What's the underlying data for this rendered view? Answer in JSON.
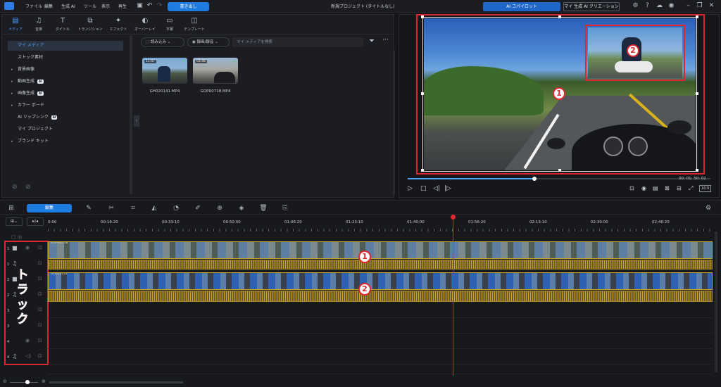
{
  "menu": [
    "ファイル",
    "編集",
    "生成 AI",
    "ツール",
    "表示",
    "再生"
  ],
  "export_label": "書き出し",
  "project_title": "新規プロジェクト (タイトルなし)",
  "ai_copilot_label": "AI コパイロット",
  "ai_create_label": "マイ 生成 AI クリエーション",
  "tabs": [
    {
      "label": "メディア",
      "icon": "media-icon"
    },
    {
      "label": "音楽",
      "icon": "music-icon"
    },
    {
      "label": "タイトル",
      "icon": "title-icon"
    },
    {
      "label": "トランジション",
      "icon": "transition-icon"
    },
    {
      "label": "エフェクト",
      "icon": "effect-icon"
    },
    {
      "label": "オーバーレイ",
      "icon": "overlay-icon"
    },
    {
      "label": "字幕",
      "icon": "subtitle-icon"
    },
    {
      "label": "テンプレート",
      "icon": "template-icon"
    }
  ],
  "sidebar": {
    "items": [
      {
        "label": "マイ メディア",
        "arrow": "",
        "badge": ""
      },
      {
        "label": "ストック素材",
        "arrow": "",
        "badge": ""
      },
      {
        "label": "背景画像",
        "arrow": "▸",
        "badge": ""
      },
      {
        "label": "動画生成",
        "arrow": "▸",
        "badge": "AI"
      },
      {
        "label": "画像生成",
        "arrow": "▸",
        "badge": "AI"
      },
      {
        "label": "カラー ボード",
        "arrow": "▸",
        "badge": ""
      },
      {
        "label": "AI リップシンク",
        "arrow": "",
        "badge": "AI"
      },
      {
        "label": "マイ プロジェクト",
        "arrow": "",
        "badge": ""
      },
      {
        "label": "ブランド キット",
        "arrow": "▸",
        "badge": ""
      }
    ]
  },
  "media_toolbar": {
    "import_label": "読み込み",
    "capture_label": "録画/録音",
    "search_placeholder": "マイ メディアを検索"
  },
  "media": [
    {
      "name": "GH020141.MP4",
      "duration": "11:47"
    },
    {
      "name": "GOPR0718.MP4",
      "duration": "03:46"
    }
  ],
  "preview": {
    "timecode": "00: 01: 50: 02",
    "aspect": "16:9",
    "annotations": [
      "1",
      "2"
    ]
  },
  "timeline": {
    "edit_label": "編集",
    "ruler_labels": [
      "0:00",
      "00:16:20",
      "00:33:10",
      "00:50:00",
      "01:06:20",
      "01:23:10",
      "01:40:00",
      "01:56:20",
      "02:13:10",
      "02:30:00",
      "02:46:20"
    ],
    "clips": [
      {
        "name": "GOPR0718",
        "annotation": "1"
      },
      {
        "name": "GH020141",
        "annotation": "2"
      }
    ],
    "track_numbers": [
      "1",
      "1",
      "2",
      "2",
      "3",
      "3",
      "4",
      "4"
    ],
    "overlay_text": "トラック"
  },
  "colors": {
    "accent": "#1e7be0",
    "annotation_red": "#e0262e",
    "clip_gold": "#c9a227",
    "playhead": "#e0262e"
  }
}
